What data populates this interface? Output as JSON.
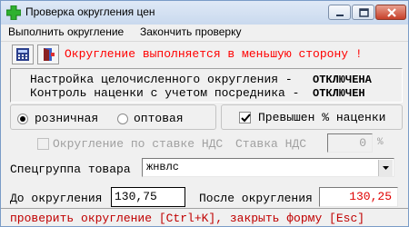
{
  "window": {
    "title": "Проверка округления цен"
  },
  "menu": {
    "items": [
      "Выполнить округление",
      "Закончить проверку"
    ]
  },
  "toolbar": {
    "alert": "Округление выполняется в меньшую сторону !"
  },
  "settings": {
    "rounding_label": "Настройка целочисленного округления -",
    "rounding_value": "ОТКЛЮЧЕНА",
    "markup_label": "Контроль наценки с учетом посредника -",
    "markup_value": "ОТКЛЮЧЕН"
  },
  "price_type": {
    "retail": "розничная",
    "wholesale": "оптовая",
    "selected": "розничная"
  },
  "markup_exceeded": {
    "label": "Превышен % наценки",
    "checked": true
  },
  "vat": {
    "checkbox_label": "Округление по ставке НДС",
    "rate_label": "Ставка НДС",
    "rate_value": "0",
    "percent": "%"
  },
  "group": {
    "label": "Спецгруппа товара",
    "value": "жнвлс"
  },
  "before": {
    "label": "До округления",
    "value": "130,75"
  },
  "after": {
    "label": "После округления",
    "value": "130,25"
  },
  "status": {
    "text": "проверить округление [Ctrl+K], закрыть форму [Esc]"
  },
  "colors": {
    "alert": "#ff0000",
    "status": "#c00000",
    "result": "#e00000"
  }
}
